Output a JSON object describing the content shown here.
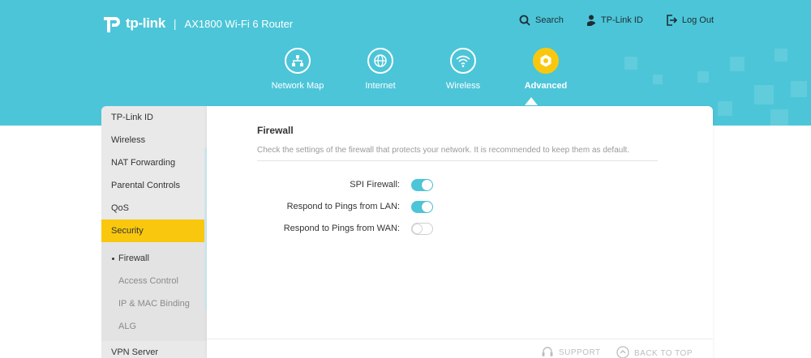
{
  "brand": {
    "logo_text": "tp-link",
    "separator": "|",
    "product": "AX1800 Wi-Fi 6 Router"
  },
  "top_links": [
    {
      "label": "Search",
      "icon": "search-icon"
    },
    {
      "label": "TP-Link ID",
      "icon": "user-icon"
    },
    {
      "label": "Log Out",
      "icon": "logout-icon"
    }
  ],
  "nav": [
    {
      "label": "Network Map",
      "icon": "network-map-icon",
      "active": false
    },
    {
      "label": "Internet",
      "icon": "globe-icon",
      "active": false
    },
    {
      "label": "Wireless",
      "icon": "wifi-icon",
      "active": false
    },
    {
      "label": "Advanced",
      "icon": "gear-icon",
      "active": true
    }
  ],
  "sidebar": {
    "items": [
      {
        "label": "TP-Link ID"
      },
      {
        "label": "Wireless"
      },
      {
        "label": "NAT Forwarding"
      },
      {
        "label": "Parental Controls"
      },
      {
        "label": "QoS"
      },
      {
        "label": "Security",
        "active": true
      },
      {
        "label": "VPN Server"
      }
    ],
    "sub_items": [
      {
        "label": "Firewall",
        "active": true
      },
      {
        "label": "Access Control"
      },
      {
        "label": "IP & MAC Binding"
      },
      {
        "label": "ALG"
      }
    ]
  },
  "firewall": {
    "title": "Firewall",
    "description": "Check the settings of the firewall that protects your network. It is recommended to keep them as default.",
    "settings": [
      {
        "label": "SPI Firewall:",
        "enabled": true
      },
      {
        "label": "Respond to Pings from LAN:",
        "enabled": true
      },
      {
        "label": "Respond to Pings from WAN:",
        "enabled": false
      }
    ]
  },
  "footer": {
    "support_label": "SUPPORT",
    "back_to_top_label": "BACK TO TOP"
  },
  "colors": {
    "header": "#4cc5d8",
    "accent": "#f9c80e",
    "toggle_on": "#4cc5d8"
  }
}
